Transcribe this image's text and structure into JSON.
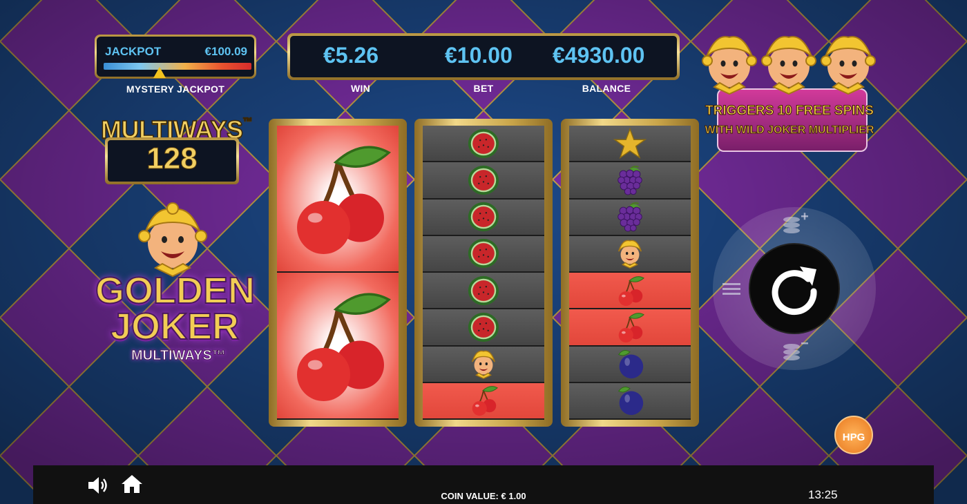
{
  "jackpot": {
    "label": "JACKPOT",
    "value": "€100.09",
    "caption": "MYSTERY JACKPOT",
    "level": 0.38
  },
  "stats": {
    "win": "€5.26",
    "bet": "€10.00",
    "balance": "€4930.00",
    "win_label": "WIN",
    "bet_label": "BET",
    "balance_label": "BALANCE"
  },
  "multiways": {
    "title": "MULTIWAYS",
    "tm": "™",
    "count": "128"
  },
  "logo": {
    "line1": "GOLDEN",
    "line2": "JOKER",
    "line3": "MULTIWAYS™"
  },
  "feature": {
    "line1": "TRIGGERS 10 FREE SPINS",
    "line2": "WITH WILD JOKER MULTIPLIER"
  },
  "reels": [
    [
      "cherry",
      "cherry"
    ],
    [
      "watermelon",
      "watermelon",
      "watermelon",
      "watermelon",
      "watermelon",
      "watermelon",
      "joker",
      "cherry"
    ],
    [
      "star",
      "grapes",
      "grapes",
      "joker",
      "cherry",
      "cherry",
      "plum",
      "plum"
    ]
  ],
  "brand": {
    "badge": "HPG"
  },
  "bottom_bar": {
    "coin_value": "COIN VALUE: € 1.00",
    "clock": "13:25"
  },
  "icons": {
    "sound": "speaker-icon",
    "home": "home-icon",
    "spin": "spin-arrow-icon",
    "menu": "menu-lines-icon",
    "bet_up": "coins-plus-icon",
    "bet_down": "coins-minus-icon"
  }
}
